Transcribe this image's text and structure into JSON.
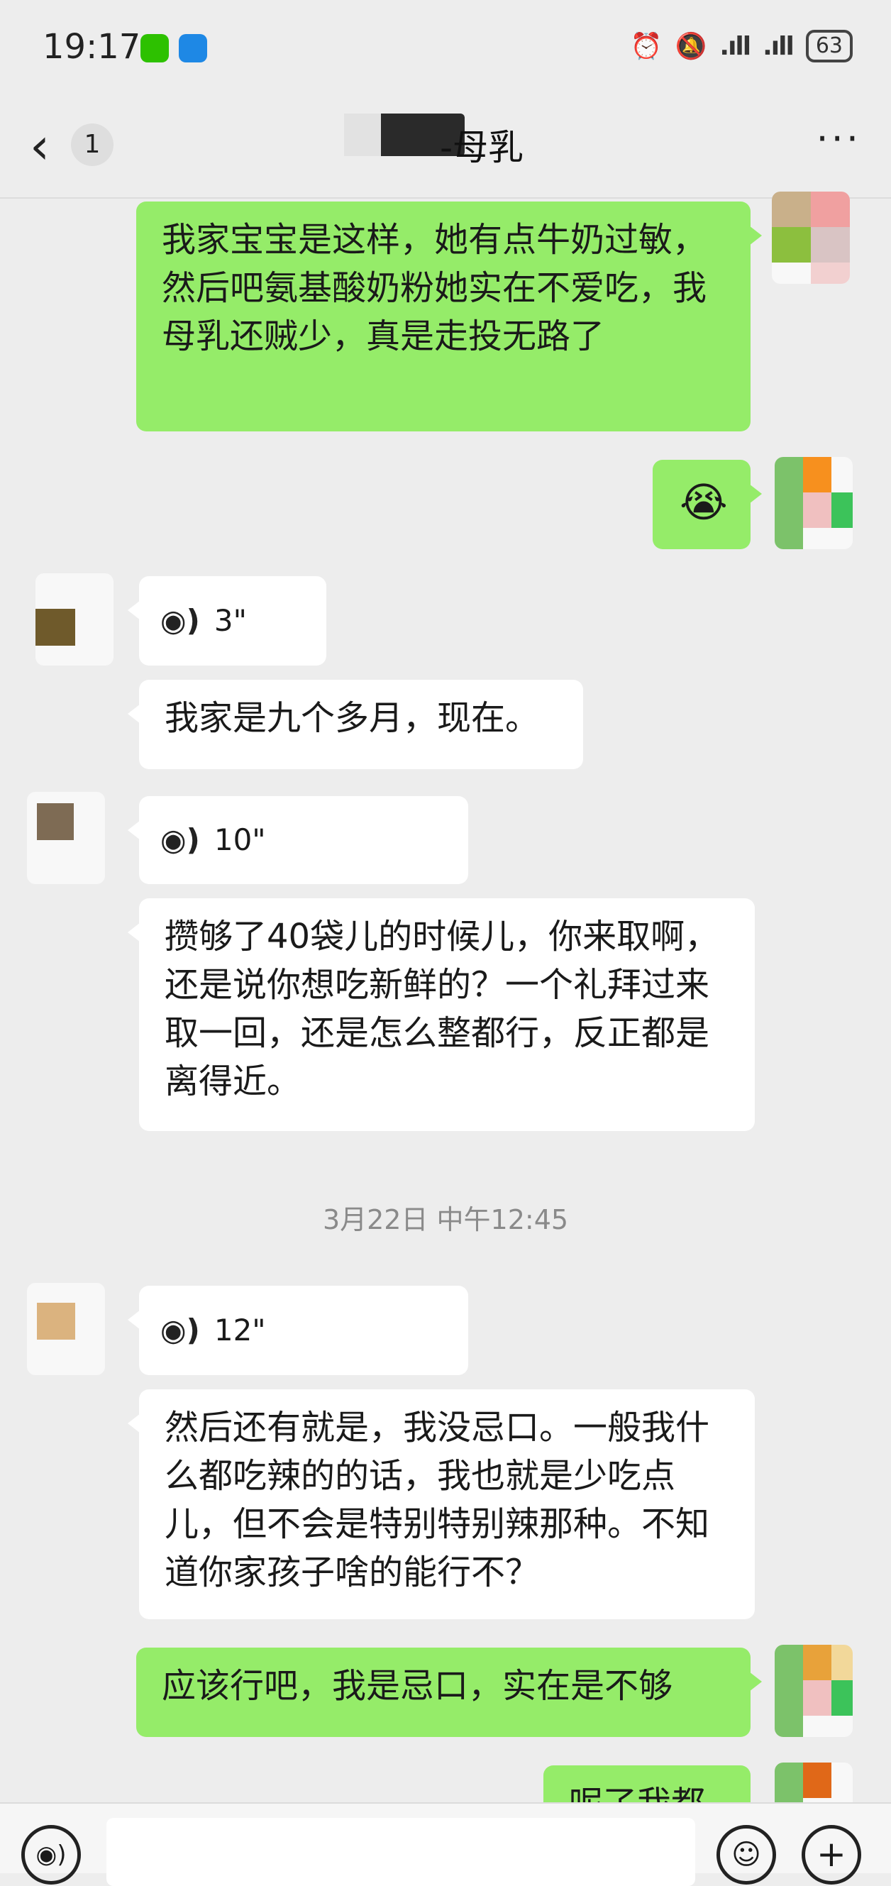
{
  "status_bar": {
    "time": "19:17",
    "battery": "63",
    "icons": [
      "wechat-notification-icon",
      "dingtalk-notification-icon",
      "alarm-icon",
      "mute-icon",
      "signal-icon",
      "signal-icon",
      "battery-icon"
    ]
  },
  "header": {
    "back_glyph": "‹",
    "unread_count": "1",
    "title": "-母乳",
    "more_glyph": "···"
  },
  "messages": [
    {
      "dir": "out",
      "type": "text",
      "text": "我家宝宝是这样，她有点牛奶过敏，然后吧氨基酸奶粉她实在不爱吃，我母乳还贼少，真是走投无路了"
    },
    {
      "dir": "out",
      "type": "emoji",
      "text": "😭"
    },
    {
      "dir": "in",
      "type": "voice",
      "duration": "3\""
    },
    {
      "dir": "in",
      "type": "text",
      "text": "我家是九个多月，现在。"
    },
    {
      "dir": "in",
      "type": "voice",
      "duration": "10\""
    },
    {
      "dir": "in",
      "type": "text",
      "text": "攒够了40袋儿的时候儿，你来取啊，还是说你想吃新鲜的？一个礼拜过来取一回，还是怎么整都行，反正都是离得近。"
    },
    {
      "dir": "in",
      "type": "voice",
      "duration": "12\""
    },
    {
      "dir": "in",
      "type": "text",
      "text": "然后还有就是，我没忌口。一般我什么都吃辣的的话，我也就是少吃点儿，但不会是特别特别辣那种。不知道你家孩子啥的能行不？"
    },
    {
      "dir": "out",
      "type": "text",
      "text": "应该行吧，我是忌口，实在是不够"
    },
    {
      "dir": "out",
      "type": "text",
      "text": "呢了我都"
    }
  ],
  "timestamp": "3月22日 中午12:45",
  "input_bar": {
    "voice_glyph": "◉)",
    "emoji_glyph": "☺",
    "plus_glyph": "+"
  },
  "colors": {
    "background": "#ededed",
    "outgoing_bubble": "#95ec69",
    "incoming_bubble": "#ffffff"
  }
}
